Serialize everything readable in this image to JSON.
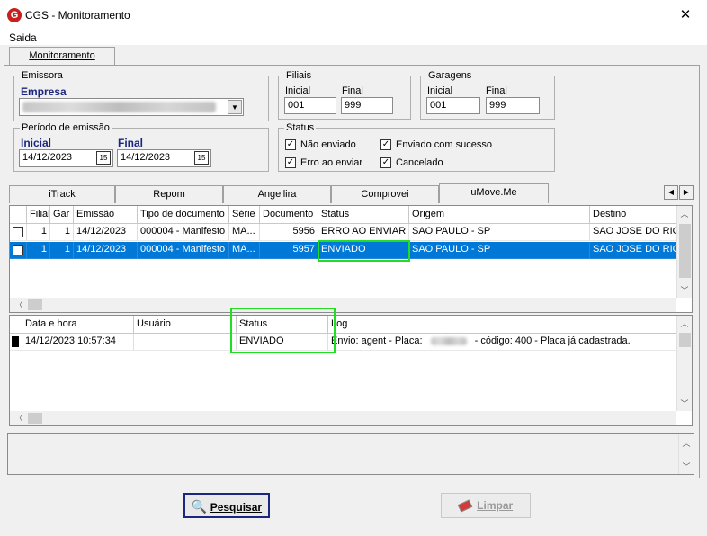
{
  "window": {
    "title": "CGS - Monitoramento",
    "logo_letter": "G",
    "close_glyph": "✕"
  },
  "menu": {
    "items": [
      "Saida"
    ]
  },
  "main_tab": {
    "label": "Monitoramento"
  },
  "emissora": {
    "legend": "Emissora",
    "empresa_label": "Empresa"
  },
  "filiais": {
    "legend": "Filiais",
    "inicial_label": "Inicial",
    "final_label": "Final",
    "inicial_value": "001",
    "final_value": "999"
  },
  "garagens": {
    "legend": "Garagens",
    "inicial_label": "Inicial",
    "final_label": "Final",
    "inicial_value": "001",
    "final_value": "999"
  },
  "periodo": {
    "legend": "Período de emissão",
    "inicial_label": "Inicial",
    "final_label": "Final",
    "inicial_value": "14/12/2023",
    "final_value": "14/12/2023",
    "calendar_glyph": "15"
  },
  "status_filter": {
    "legend": "Status",
    "options": [
      {
        "label": "Não enviado",
        "checked": true
      },
      {
        "label": "Enviado com sucesso",
        "checked": true
      },
      {
        "label": "Erro ao enviar",
        "checked": true
      },
      {
        "label": "Cancelado",
        "checked": true
      }
    ],
    "check_glyph": "✓"
  },
  "subtabs": {
    "items": [
      "iTrack",
      "Repom",
      "Angellira",
      "Comprovei",
      "uMove.Me"
    ],
    "active": "uMove.Me",
    "scroll_left": "◀",
    "scroll_right": "▶"
  },
  "documents_grid": {
    "columns": [
      "Filial",
      "Gar",
      "Emissão",
      "Tipo de documento",
      "Série",
      "Documento",
      "Status",
      "Origem",
      "Destino"
    ],
    "rows": [
      {
        "filial": "1",
        "gar": "1",
        "emissao": "14/12/2023",
        "tipo": "000004 - Manifesto",
        "serie": "MA...",
        "documento": "5956",
        "status": "ERRO AO ENVIAR",
        "origem": "SAO PAULO - SP",
        "destino": "SAO JOSE DO RIO",
        "selected": false
      },
      {
        "filial": "1",
        "gar": "1",
        "emissao": "14/12/2023",
        "tipo": "000004 - Manifesto",
        "serie": "MA...",
        "documento": "5957",
        "status": "ENVIADO",
        "origem": "SAO PAULO - SP",
        "destino": "SAO JOSE DO RIO",
        "selected": true
      }
    ]
  },
  "log_grid": {
    "columns": [
      "Data e hora",
      "Usuário",
      "Status",
      "Log"
    ],
    "rows": [
      {
        "data_hora": "14/12/2023 10:57:34",
        "usuario": "",
        "status": "ENVIADO",
        "log_prefix": "Envio: agent - Placa:",
        "log_suffix": "- código: 400 - Placa já cadastrada."
      }
    ]
  },
  "scroll_glyphs": {
    "up": "︿",
    "down": "﹀",
    "left": "〈",
    "right": "〉"
  },
  "colors": {
    "selection": "#0078d7",
    "highlight": "#22dd22",
    "label_blue": "#1b2680",
    "logo_red": "#c8201e"
  },
  "buttons": {
    "pesquisar": {
      "label": "Pesquisar",
      "icon": "search-icon"
    },
    "limpar": {
      "label": "Limpar",
      "icon": "eraser-icon",
      "disabled": true
    }
  }
}
